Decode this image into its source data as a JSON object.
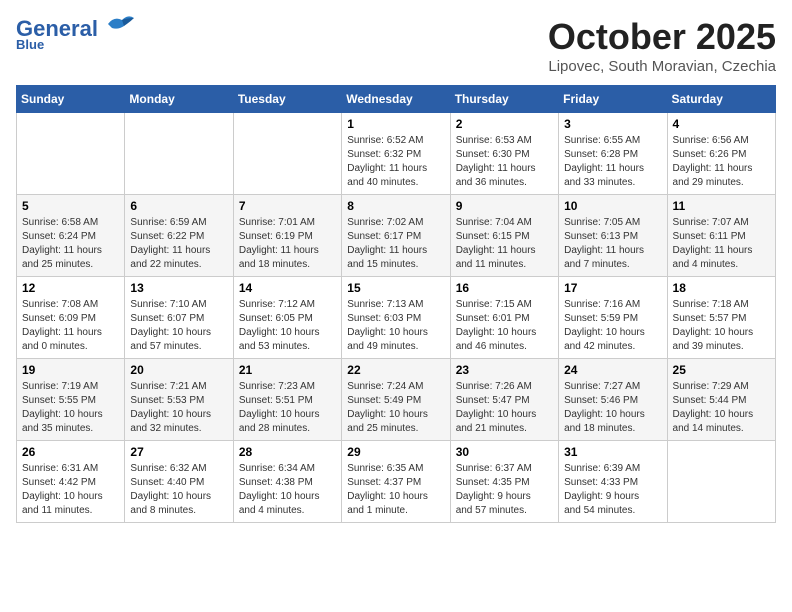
{
  "header": {
    "logo_line1": "General",
    "logo_line2": "Blue",
    "month_title": "October 2025",
    "location": "Lipovec, South Moravian, Czechia"
  },
  "weekdays": [
    "Sunday",
    "Monday",
    "Tuesday",
    "Wednesday",
    "Thursday",
    "Friday",
    "Saturday"
  ],
  "weeks": [
    [
      {
        "day": "",
        "info": ""
      },
      {
        "day": "",
        "info": ""
      },
      {
        "day": "",
        "info": ""
      },
      {
        "day": "1",
        "info": "Sunrise: 6:52 AM\nSunset: 6:32 PM\nDaylight: 11 hours\nand 40 minutes."
      },
      {
        "day": "2",
        "info": "Sunrise: 6:53 AM\nSunset: 6:30 PM\nDaylight: 11 hours\nand 36 minutes."
      },
      {
        "day": "3",
        "info": "Sunrise: 6:55 AM\nSunset: 6:28 PM\nDaylight: 11 hours\nand 33 minutes."
      },
      {
        "day": "4",
        "info": "Sunrise: 6:56 AM\nSunset: 6:26 PM\nDaylight: 11 hours\nand 29 minutes."
      }
    ],
    [
      {
        "day": "5",
        "info": "Sunrise: 6:58 AM\nSunset: 6:24 PM\nDaylight: 11 hours\nand 25 minutes."
      },
      {
        "day": "6",
        "info": "Sunrise: 6:59 AM\nSunset: 6:22 PM\nDaylight: 11 hours\nand 22 minutes."
      },
      {
        "day": "7",
        "info": "Sunrise: 7:01 AM\nSunset: 6:19 PM\nDaylight: 11 hours\nand 18 minutes."
      },
      {
        "day": "8",
        "info": "Sunrise: 7:02 AM\nSunset: 6:17 PM\nDaylight: 11 hours\nand 15 minutes."
      },
      {
        "day": "9",
        "info": "Sunrise: 7:04 AM\nSunset: 6:15 PM\nDaylight: 11 hours\nand 11 minutes."
      },
      {
        "day": "10",
        "info": "Sunrise: 7:05 AM\nSunset: 6:13 PM\nDaylight: 11 hours\nand 7 minutes."
      },
      {
        "day": "11",
        "info": "Sunrise: 7:07 AM\nSunset: 6:11 PM\nDaylight: 11 hours\nand 4 minutes."
      }
    ],
    [
      {
        "day": "12",
        "info": "Sunrise: 7:08 AM\nSunset: 6:09 PM\nDaylight: 11 hours\nand 0 minutes."
      },
      {
        "day": "13",
        "info": "Sunrise: 7:10 AM\nSunset: 6:07 PM\nDaylight: 10 hours\nand 57 minutes."
      },
      {
        "day": "14",
        "info": "Sunrise: 7:12 AM\nSunset: 6:05 PM\nDaylight: 10 hours\nand 53 minutes."
      },
      {
        "day": "15",
        "info": "Sunrise: 7:13 AM\nSunset: 6:03 PM\nDaylight: 10 hours\nand 49 minutes."
      },
      {
        "day": "16",
        "info": "Sunrise: 7:15 AM\nSunset: 6:01 PM\nDaylight: 10 hours\nand 46 minutes."
      },
      {
        "day": "17",
        "info": "Sunrise: 7:16 AM\nSunset: 5:59 PM\nDaylight: 10 hours\nand 42 minutes."
      },
      {
        "day": "18",
        "info": "Sunrise: 7:18 AM\nSunset: 5:57 PM\nDaylight: 10 hours\nand 39 minutes."
      }
    ],
    [
      {
        "day": "19",
        "info": "Sunrise: 7:19 AM\nSunset: 5:55 PM\nDaylight: 10 hours\nand 35 minutes."
      },
      {
        "day": "20",
        "info": "Sunrise: 7:21 AM\nSunset: 5:53 PM\nDaylight: 10 hours\nand 32 minutes."
      },
      {
        "day": "21",
        "info": "Sunrise: 7:23 AM\nSunset: 5:51 PM\nDaylight: 10 hours\nand 28 minutes."
      },
      {
        "day": "22",
        "info": "Sunrise: 7:24 AM\nSunset: 5:49 PM\nDaylight: 10 hours\nand 25 minutes."
      },
      {
        "day": "23",
        "info": "Sunrise: 7:26 AM\nSunset: 5:47 PM\nDaylight: 10 hours\nand 21 minutes."
      },
      {
        "day": "24",
        "info": "Sunrise: 7:27 AM\nSunset: 5:46 PM\nDaylight: 10 hours\nand 18 minutes."
      },
      {
        "day": "25",
        "info": "Sunrise: 7:29 AM\nSunset: 5:44 PM\nDaylight: 10 hours\nand 14 minutes."
      }
    ],
    [
      {
        "day": "26",
        "info": "Sunrise: 6:31 AM\nSunset: 4:42 PM\nDaylight: 10 hours\nand 11 minutes."
      },
      {
        "day": "27",
        "info": "Sunrise: 6:32 AM\nSunset: 4:40 PM\nDaylight: 10 hours\nand 8 minutes."
      },
      {
        "day": "28",
        "info": "Sunrise: 6:34 AM\nSunset: 4:38 PM\nDaylight: 10 hours\nand 4 minutes."
      },
      {
        "day": "29",
        "info": "Sunrise: 6:35 AM\nSunset: 4:37 PM\nDaylight: 10 hours\nand 1 minute."
      },
      {
        "day": "30",
        "info": "Sunrise: 6:37 AM\nSunset: 4:35 PM\nDaylight: 9 hours\nand 57 minutes."
      },
      {
        "day": "31",
        "info": "Sunrise: 6:39 AM\nSunset: 4:33 PM\nDaylight: 9 hours\nand 54 minutes."
      },
      {
        "day": "",
        "info": ""
      }
    ]
  ]
}
